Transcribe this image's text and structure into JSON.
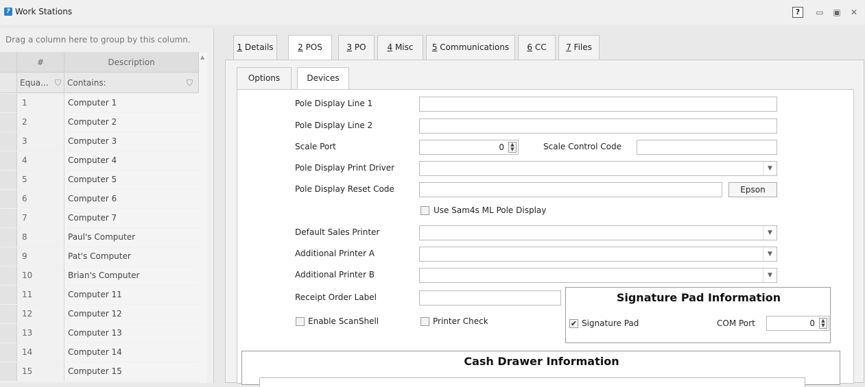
{
  "window": {
    "title": "Work Stations",
    "help_label": "?",
    "minimize_glyph": "▭",
    "restore_glyph": "▣",
    "close_glyph": "✕"
  },
  "grid": {
    "group_hint": "Drag a column here to group by this column.",
    "columns": {
      "num": "#",
      "desc": "Description"
    },
    "filters": {
      "num": "Equa...",
      "desc": "Contains:"
    },
    "rows": [
      {
        "num": "1",
        "desc": "Computer 1"
      },
      {
        "num": "2",
        "desc": "Computer 2"
      },
      {
        "num": "3",
        "desc": "Computer 3"
      },
      {
        "num": "4",
        "desc": "Computer 4"
      },
      {
        "num": "5",
        "desc": "Computer 5"
      },
      {
        "num": "6",
        "desc": "Computer 6"
      },
      {
        "num": "7",
        "desc": "Computer 7"
      },
      {
        "num": "8",
        "desc": "Paul's Computer"
      },
      {
        "num": "9",
        "desc": "Pat's Computer"
      },
      {
        "num": "10",
        "desc": "Brian's Computer"
      },
      {
        "num": "11",
        "desc": "Computer 11"
      },
      {
        "num": "12",
        "desc": "Computer 12"
      },
      {
        "num": "13",
        "desc": "Computer 13"
      },
      {
        "num": "14",
        "desc": "Computer 14"
      },
      {
        "num": "15",
        "desc": "Computer 15"
      }
    ]
  },
  "tabs": [
    {
      "key": "1",
      "label": " Details"
    },
    {
      "key": "2",
      "label": " POS"
    },
    {
      "key": "3",
      "label": " PO"
    },
    {
      "key": "4",
      "label": " Misc"
    },
    {
      "key": "5",
      "label": " Communications"
    },
    {
      "key": "6",
      "label": " CC"
    },
    {
      "key": "7",
      "label": " Files"
    }
  ],
  "subtabs": {
    "options": "Options",
    "devices": "Devices"
  },
  "form": {
    "pole_line1_label": "Pole Display Line 1",
    "pole_line2_label": "Pole Display Line 2",
    "scale_port_label": "Scale Port",
    "scale_port_value": "0",
    "scale_control_label": "Scale Control Code",
    "pole_driver_label": "Pole Display Print Driver",
    "pole_reset_label": "Pole Display Reset Code",
    "epson_button": "Epson",
    "sam4s_label": "Use Sam4s ML Pole Display",
    "default_printer_label": "Default Sales Printer",
    "printer_a_label": "Additional Printer A",
    "printer_b_label": "Additional Printer B",
    "receipt_label": "Receipt Order Label",
    "scanshell_label": "Enable ScanShell",
    "printer_check_label": "Printer Check"
  },
  "signature_pad": {
    "title": "Signature Pad Information",
    "checkbox_label": "Signature Pad",
    "checked_glyph": "✔",
    "com_port_label": "COM Port",
    "com_port_value": "0"
  },
  "cash_drawer": {
    "title": "Cash Drawer Information"
  },
  "glyphs": {
    "funnel": "⛉",
    "up_arrow": "▲",
    "spin_up": "▲",
    "spin_down": "▼",
    "dropdown": "▼"
  }
}
